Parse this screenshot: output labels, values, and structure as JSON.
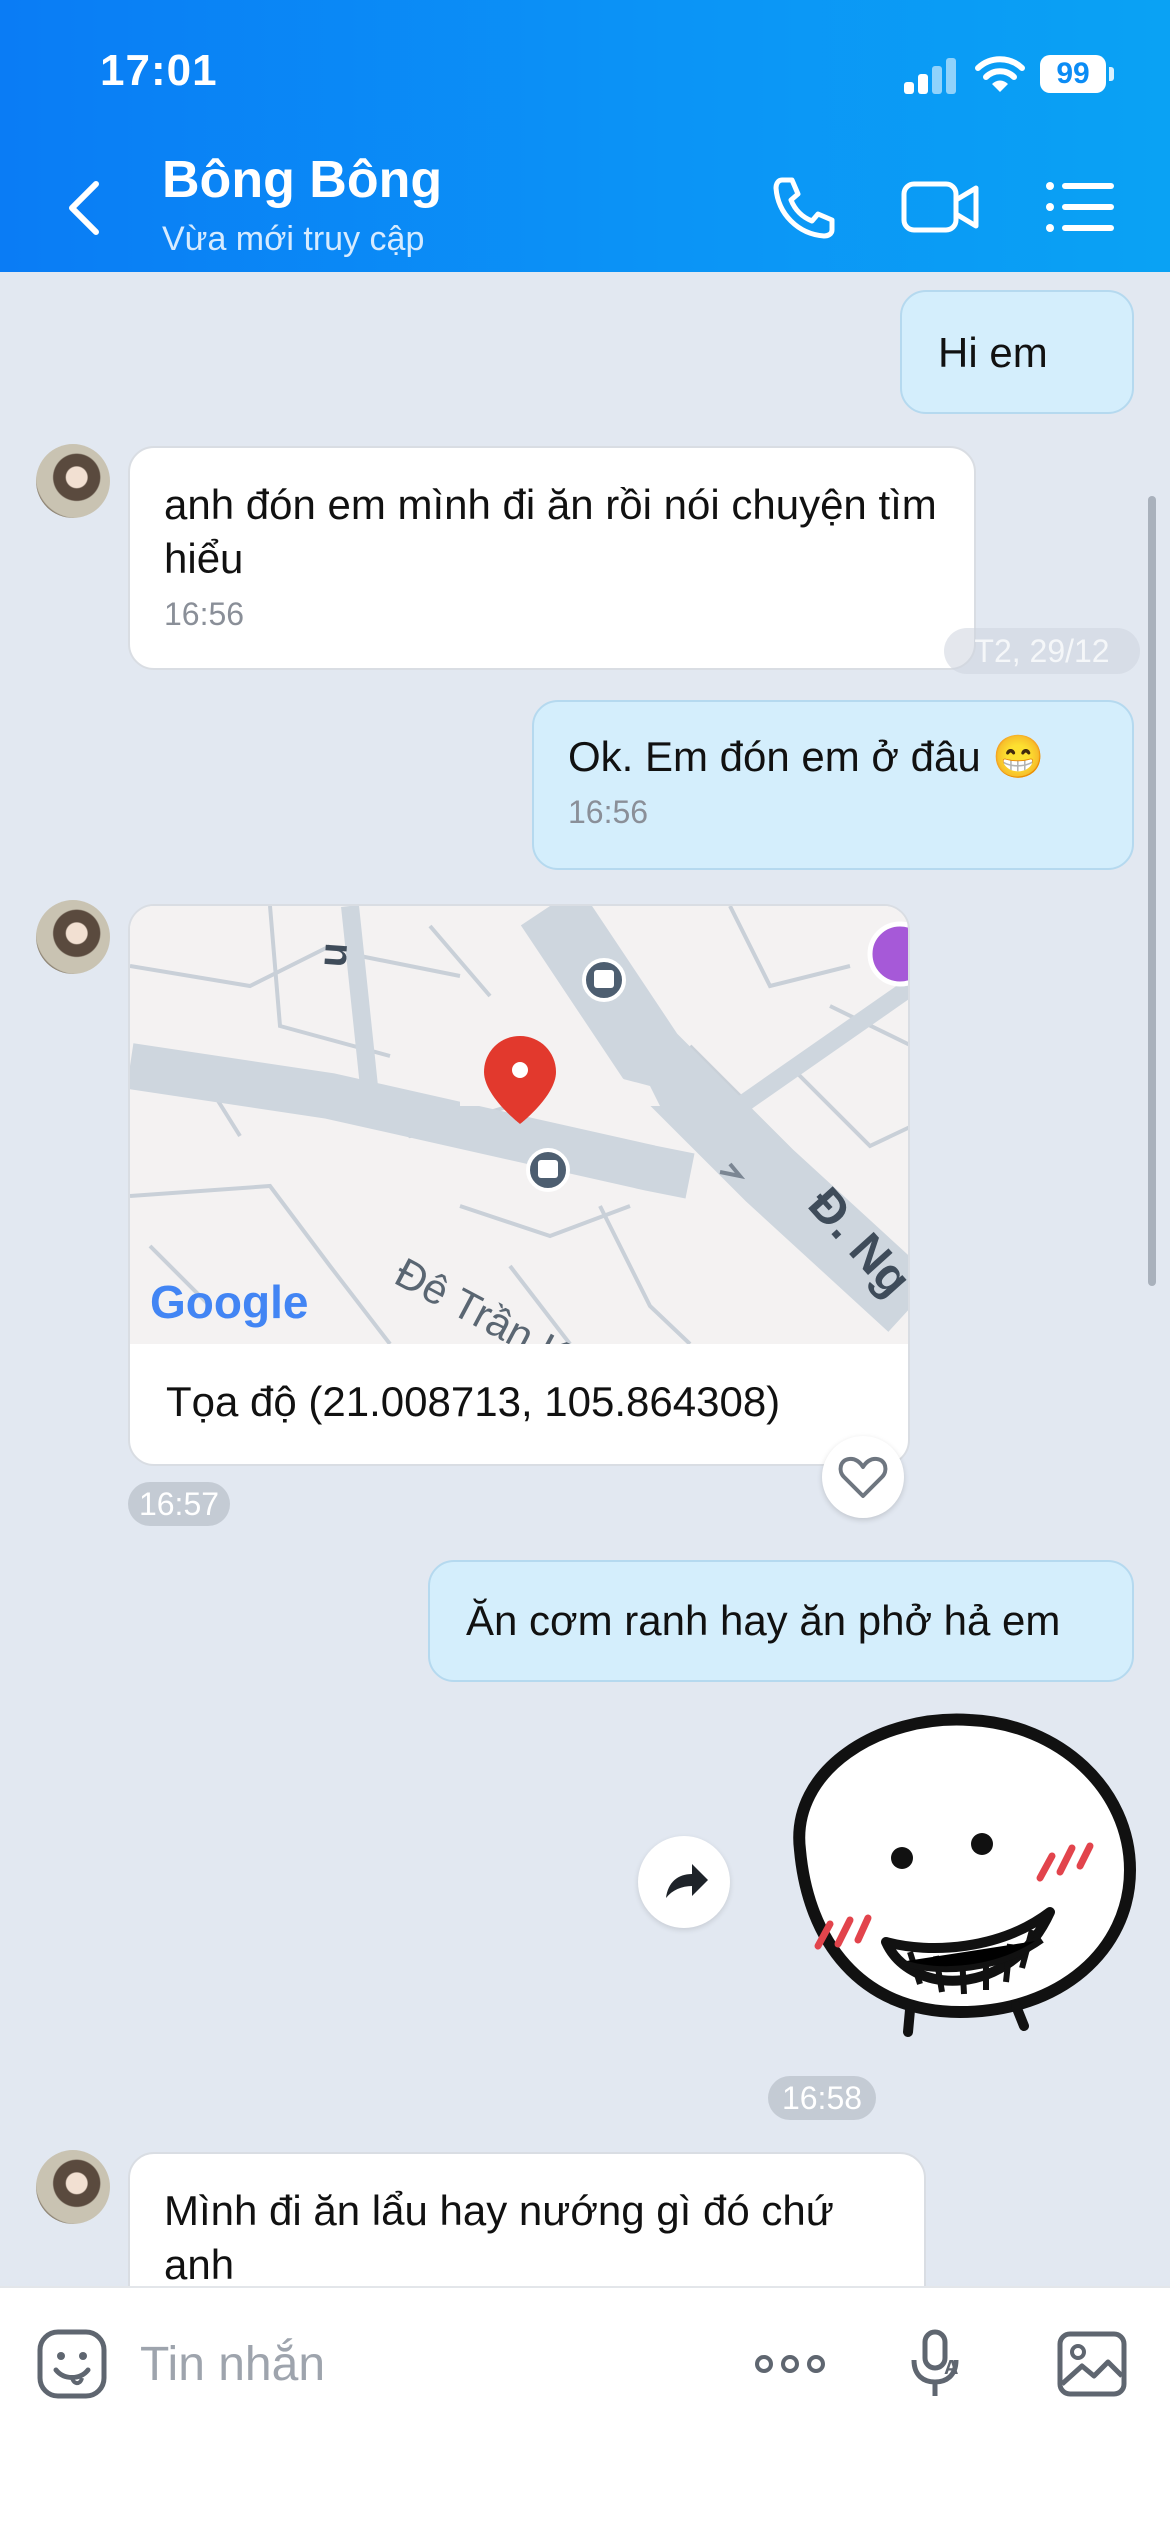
{
  "status_bar": {
    "time": "17:01",
    "battery": "99"
  },
  "header": {
    "contact_name": "Bông Bông",
    "status": "Vừa mới truy cập"
  },
  "date_separator": "T2, 29/12",
  "messages": [
    {
      "from": "me",
      "text": "Hi em"
    },
    {
      "from": "them",
      "text": "anh đón em mình đi ăn rồi nói chuyện tìm hiểu",
      "time": "16:56"
    },
    {
      "from": "me",
      "text": "Ok. Em  đón em ở đâu 😁",
      "time": "16:56"
    },
    {
      "from": "them",
      "type": "location",
      "caption": "Tọa độ (21.008713, 105.864308)",
      "time": "16:57",
      "map_labels": {
        "street1": "Đê Trần K",
        "street2": "Đ. Ng",
        "street3": "n",
        "logo": "Google"
      }
    },
    {
      "from": "me",
      "text": "Ăn cơm ranh hay ăn phở hả em"
    },
    {
      "from": "me",
      "type": "sticker",
      "time": "16:58"
    },
    {
      "from": "them",
      "text": "Mình đi ăn lẩu hay nướng gì đó chứ anh"
    }
  ],
  "composer": {
    "placeholder": "Tin nhắn"
  },
  "colors": {
    "header_blue": "#0a8af5",
    "bubble_me": "#d4eefc",
    "bubble_them": "#ffffff",
    "chat_bg": "#e2e8f1"
  }
}
